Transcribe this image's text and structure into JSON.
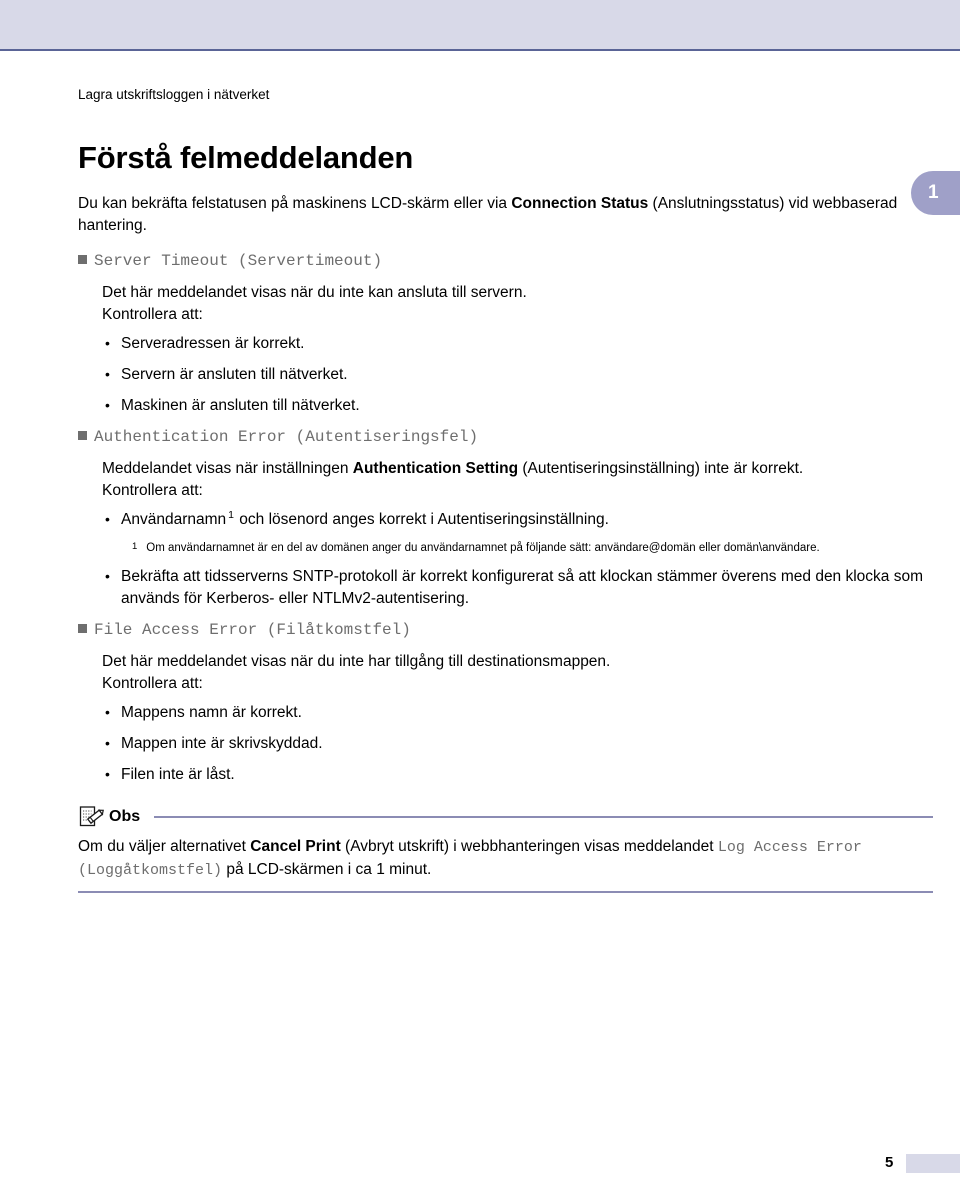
{
  "header": {
    "running_head": "Lagra utskriftsloggen i nätverket",
    "side_tab_number": "1",
    "banner_color": "#d8d9e8",
    "banner_border_color": "#5a6496",
    "side_tab_color": "#9fa0c8"
  },
  "page_title": "Förstå felmeddelanden",
  "intro": "Du kan bekräfta felstatusen på maskinens LCD-skärm eller via Connection Status (Anslutningsstatus) vid webbaserad hantering.",
  "intro_parts": {
    "before_bold": "Du kan bekräfta felstatusen på maskinens LCD-skärm eller via ",
    "bold": "Connection Status",
    "after_bold": " (Anslutningsstatus) vid webbaserad hantering."
  },
  "sections": [
    {
      "heading": "Server Timeout (Servertimeout)",
      "body": "Det här meddelandet visas när du inte kan ansluta till servern.",
      "check_label": "Kontrollera att:",
      "items": [
        "Serveradressen är korrekt.",
        "Servern är ansluten till nätverket.",
        "Maskinen är ansluten till nätverket."
      ]
    },
    {
      "heading": "Authentication Error (Autentiseringsfel)",
      "body_before_bold": "Meddelandet visas när inställningen ",
      "body_bold": "Authentication Setting",
      "body_after_bold": " (Autentiseringsinställning) inte är korrekt.",
      "check_label": "Kontrollera att:",
      "item_1_before_sup": "Användarnamn",
      "item_1_sup": "1",
      "item_1_after_sup": " och lösenord anges korrekt i Autentiseringsinställning.",
      "footnote_mark": "1",
      "footnote_text": "Om användarnamnet är en del av domänen anger du användarnamnet på följande sätt: användare@domän eller domän\\användare.",
      "item_2": "Bekräfta att tidsserverns SNTP-protokoll är korrekt konfigurerat så att klockan stämmer överens med den klocka som används för Kerberos- eller NTLMv2-autentisering."
    },
    {
      "heading": "File Access Error (Filåtkomstfel)",
      "body": "Det här meddelandet visas när du inte har tillgång till destinationsmappen.",
      "check_label": "Kontrollera att:",
      "items": [
        "Mappens namn är korrekt.",
        "Mappen inte är skrivskyddad.",
        "Filen inte är låst."
      ]
    }
  ],
  "note": {
    "icon": "note-pencil-icon",
    "title": "Obs",
    "line1_before_bold": "Om du väljer alternativet ",
    "line1_bold": "Cancel Print",
    "line1_after_bold": " (Avbryt utskrift) i webbhanteringen visas meddelandet",
    "line2_mono": "Log Access Error (Loggåtkomstfel)",
    "line2_after": " på LCD-skärmen i ca 1 minut.",
    "rule_color": "#8b8cb4"
  },
  "footer": {
    "page_number": "5",
    "block_color": "#d8d9e8"
  }
}
